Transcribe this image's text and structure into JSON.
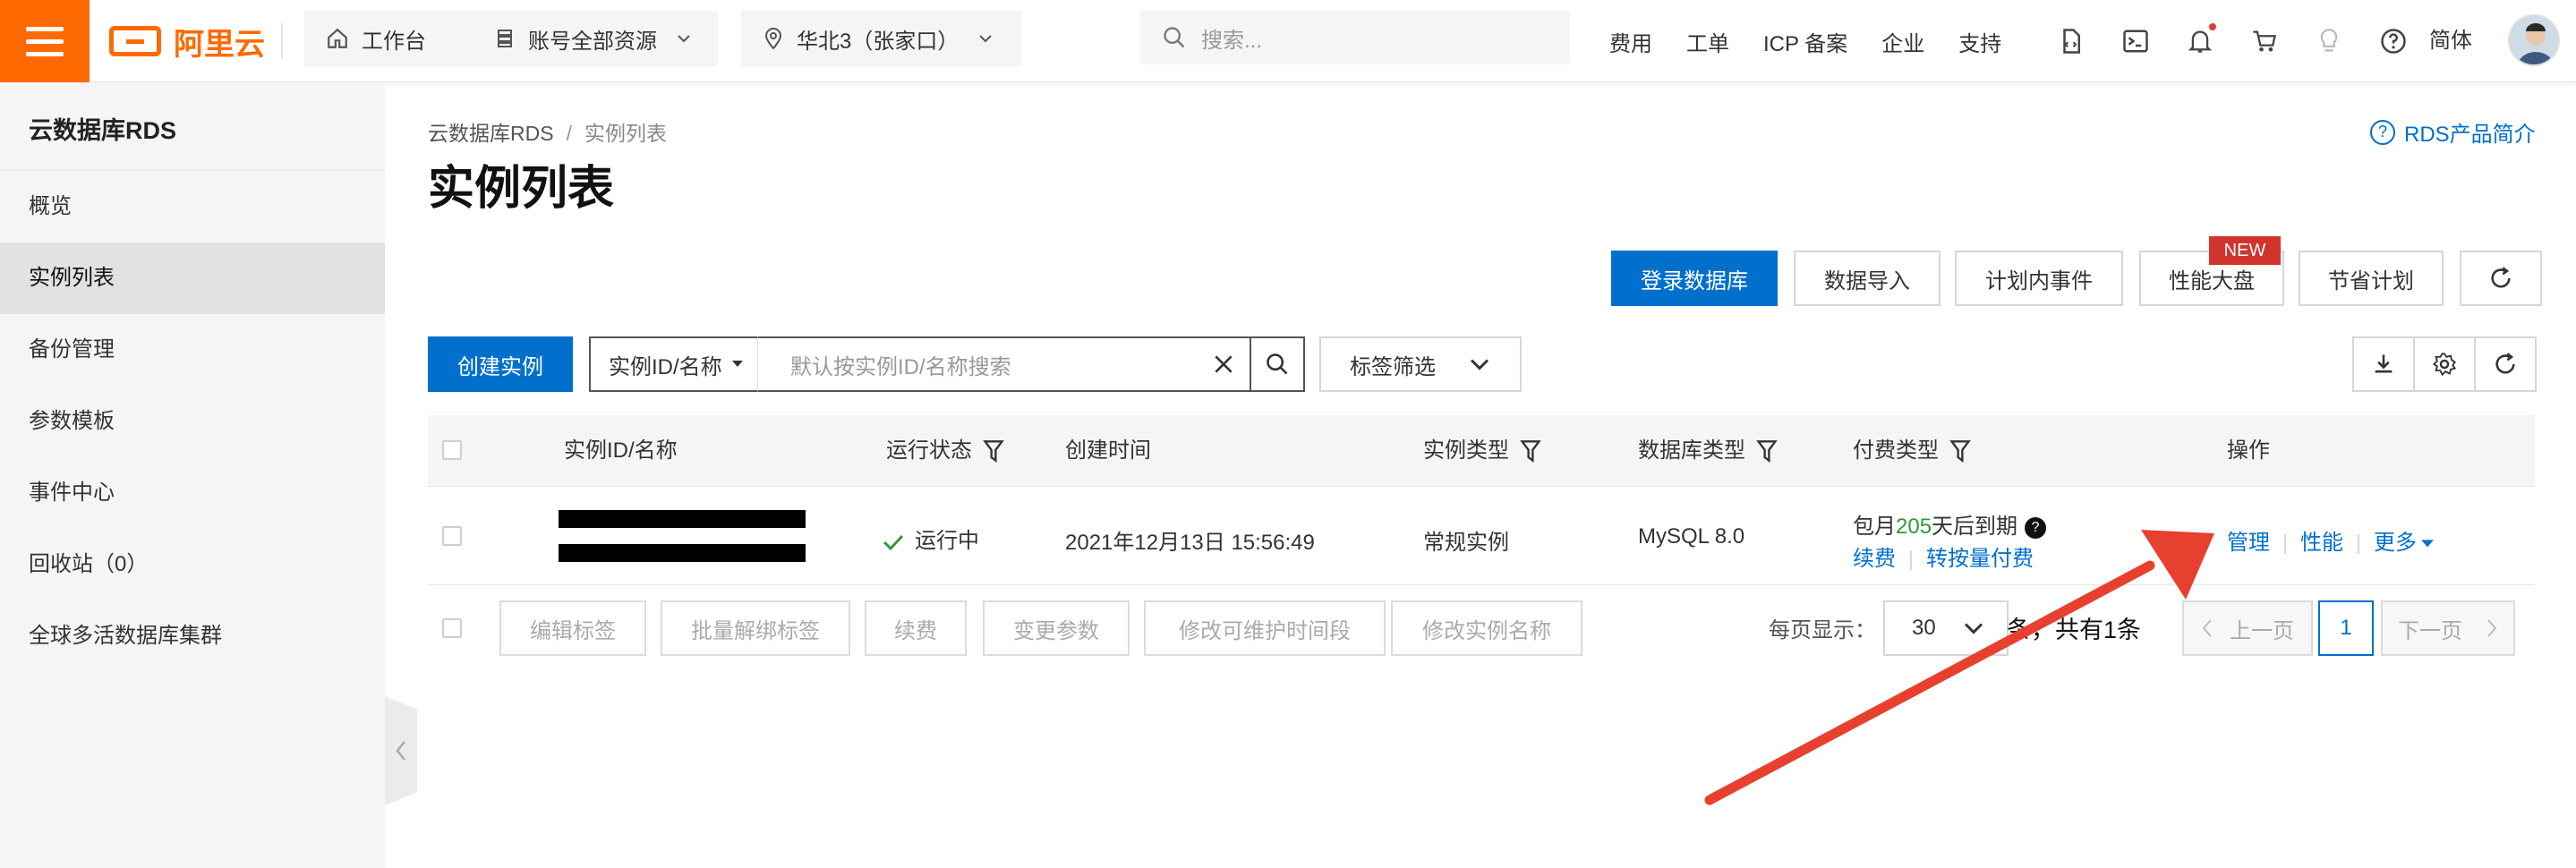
{
  "topbar": {
    "logo_text": "阿里云",
    "workbench": "工作台",
    "resource_scope": "账号全部资源",
    "region": "华北3（张家口）",
    "search_placeholder": "搜索...",
    "links": [
      "费用",
      "工单",
      "ICP 备案",
      "企业",
      "支持"
    ],
    "language": "简体"
  },
  "sidebar": {
    "title": "云数据库RDS",
    "items": [
      {
        "label": "概览"
      },
      {
        "label": "实例列表"
      },
      {
        "label": "备份管理"
      },
      {
        "label": "参数模板"
      },
      {
        "label": "事件中心"
      },
      {
        "label": "回收站（0）"
      },
      {
        "label": "全球多活数据库集群"
      }
    ]
  },
  "breadcrumb": {
    "root": "云数据库RDS",
    "separator": "/",
    "current": "实例列表"
  },
  "page": {
    "title": "实例列表",
    "help_link": "RDS产品简介",
    "help_icon_glyph": "?"
  },
  "toolbar": {
    "login_db": "登录数据库",
    "data_import": "数据导入",
    "planned_events": "计划内事件",
    "perf_dashboard": "性能大盘",
    "new_badge": "NEW",
    "savings_plan": "节省计划",
    "create_instance": "创建实例"
  },
  "filter": {
    "field_select": "实例ID/名称",
    "search_placeholder": "默认按实例ID/名称搜索",
    "tag_filter": "标签筛选"
  },
  "table": {
    "headers": [
      "实例ID/名称",
      "运行状态",
      "创建时间",
      "实例类型",
      "数据库类型",
      "付费类型",
      "操作"
    ],
    "rows": [
      {
        "status": "运行中",
        "created": "2021年12月13日 15:56:49",
        "instance_type": "常规实例",
        "db_type": "MySQL 8.0",
        "pay_prefix": "包月",
        "pay_days": "205",
        "pay_suffix": "天后到期",
        "pay_help_glyph": "?",
        "renew": "续费",
        "switch_pay": "转按量付费",
        "action_manage": "管理",
        "action_perf": "性能",
        "action_more": "更多"
      }
    ]
  },
  "batch": {
    "edit_tags": "编辑标签",
    "unbind_tags": "批量解绑标签",
    "renew": "续费",
    "change_params": "变更参数",
    "maint_window": "修改可维护时间段",
    "rename": "修改实例名称"
  },
  "pager": {
    "label": "每页显示：",
    "page_size": "30",
    "total": "条，共有1条",
    "prev": "上一页",
    "current_page": "1",
    "next": "下一页"
  },
  "colors": {
    "brand_orange": "#ff6a00",
    "primary_blue": "#0070cc",
    "new_badge_red": "#d0342c",
    "annotation_arrow": "#e8402e",
    "status_green": "#2f9a3c"
  }
}
